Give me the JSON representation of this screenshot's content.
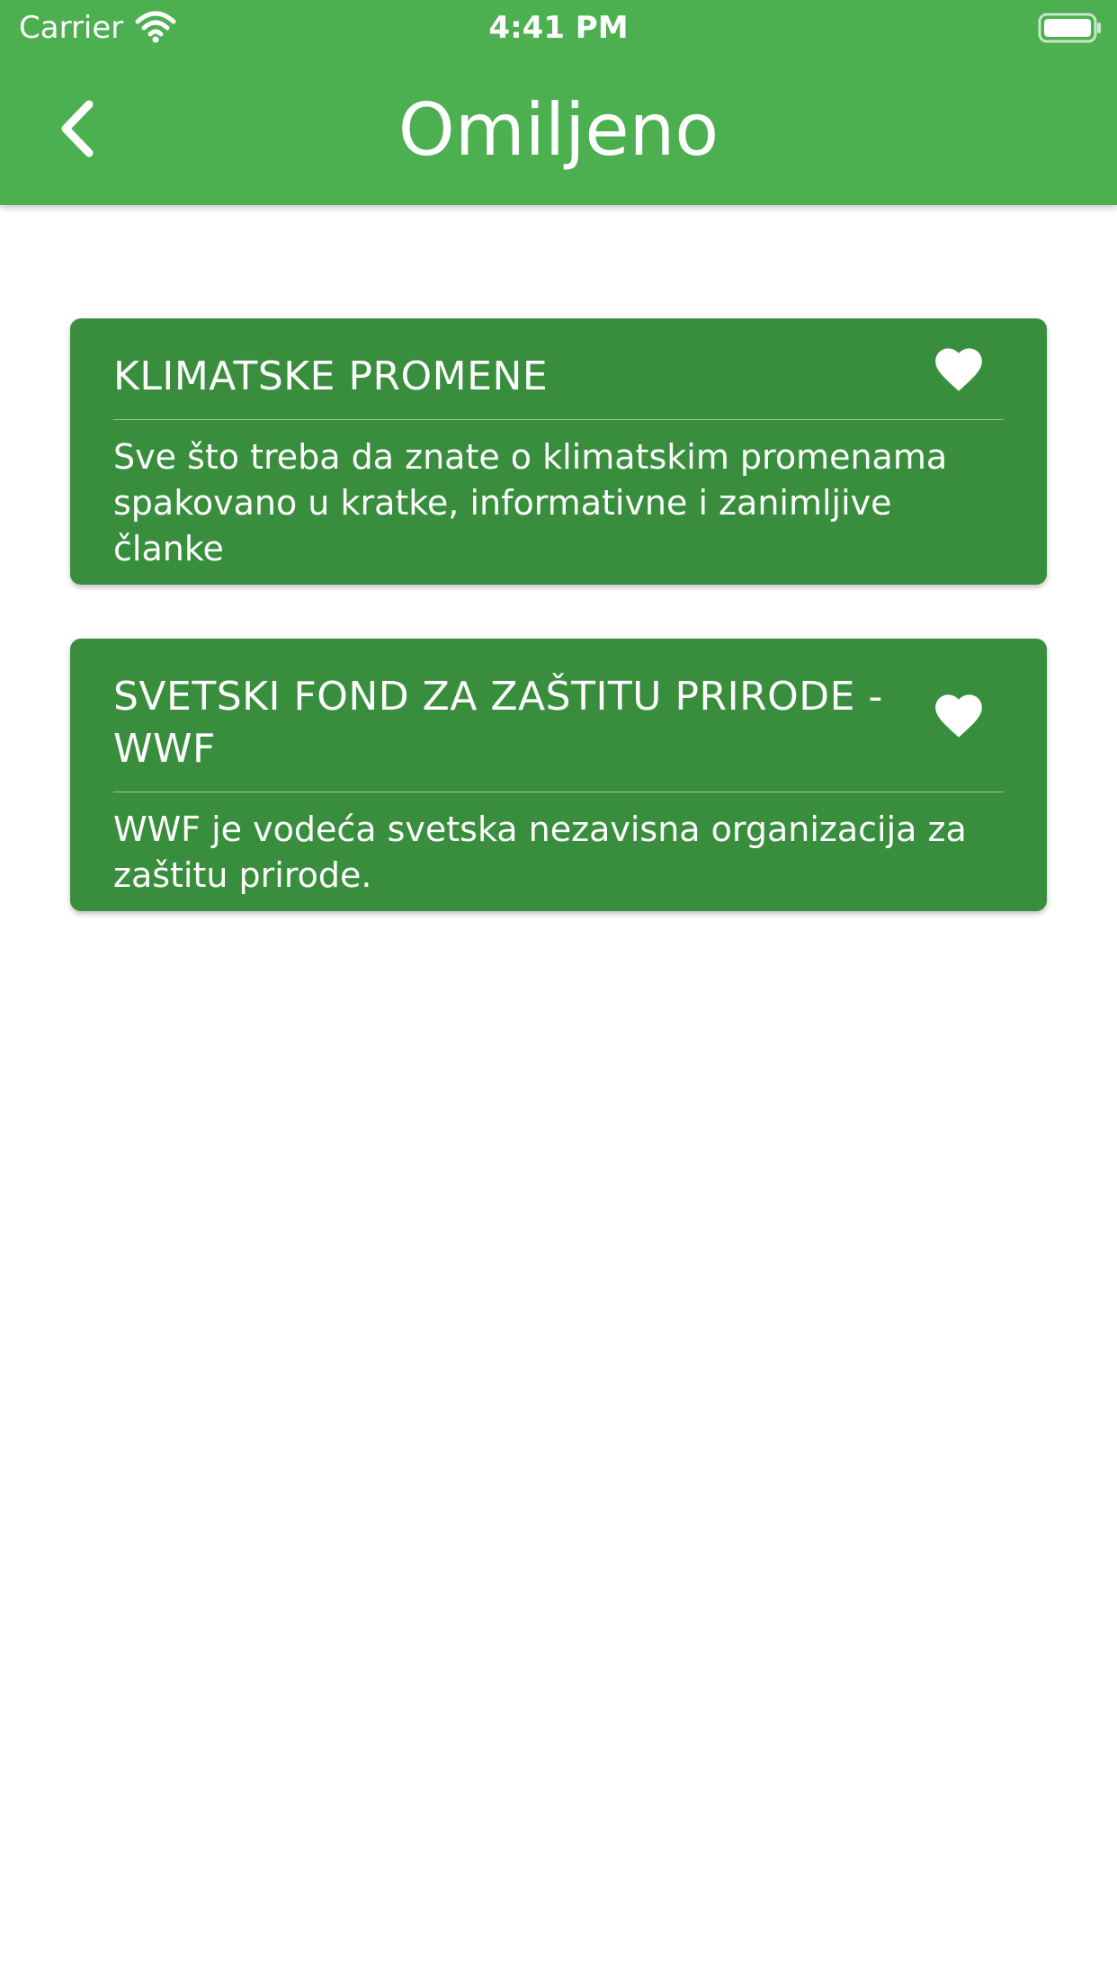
{
  "status_bar": {
    "carrier": "Carrier",
    "time": "4:41 PM",
    "wifi_icon": "wifi-icon",
    "battery_icon": "battery-full-icon"
  },
  "app_bar": {
    "title": "Omiljeno",
    "back_icon": "chevron-left-icon",
    "background_color": "#4caf50"
  },
  "favorites": [
    {
      "title": "KLIMATSKE PROMENE",
      "description": "Sve što treba da znate o klimatskim promenama spakovano u kratke, informativne i zanimljive članke",
      "icon": "heart-icon"
    },
    {
      "title": "SVETSKI FOND ZA ZAŠTITU PRIRODE - WWF",
      "description": "WWF je vodeća svetska nezavisna organizacija za zaštitu prirode.",
      "icon": "heart-icon"
    }
  ],
  "colors": {
    "card_background": "#388e3c",
    "text": "#ffffff"
  }
}
